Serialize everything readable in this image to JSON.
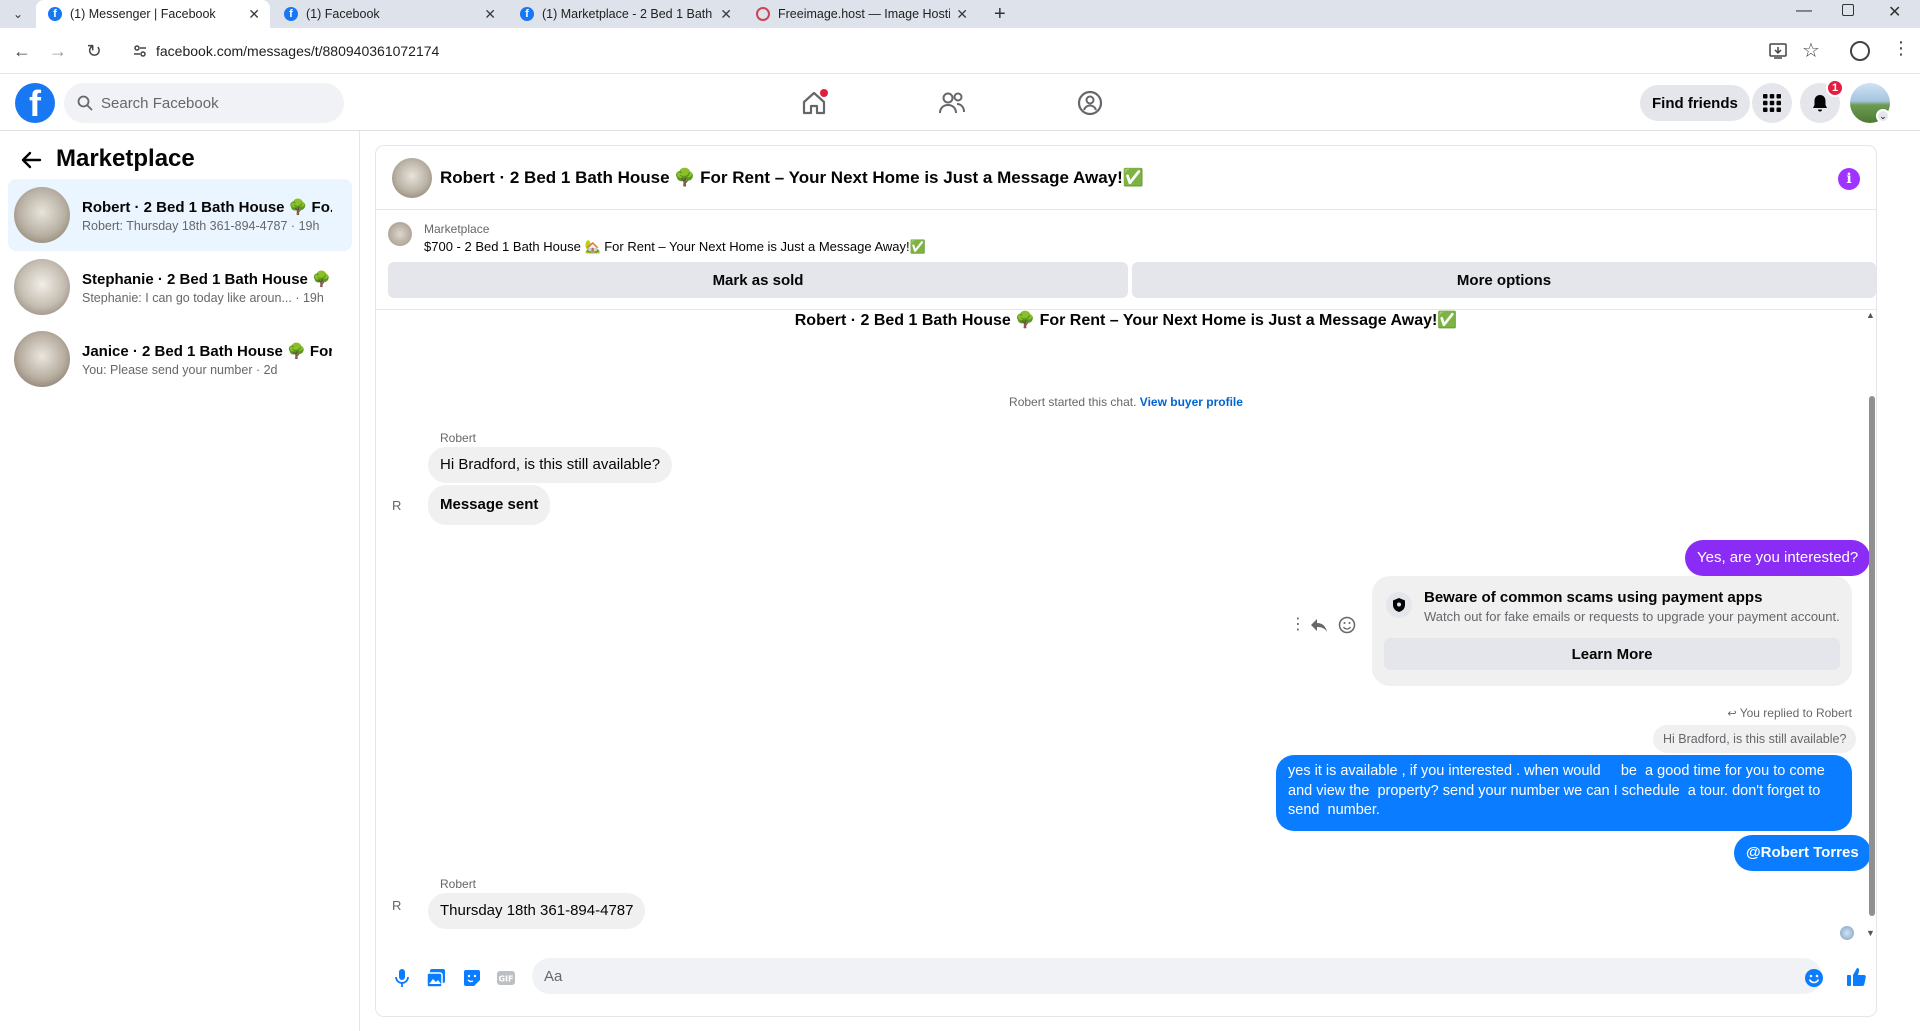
{
  "browser": {
    "tabs": [
      {
        "title": "(1) Messenger | Facebook",
        "active": true
      },
      {
        "title": "(1) Facebook",
        "active": false
      },
      {
        "title": "(1) Marketplace - 2 Bed 1 Bath H",
        "active": false
      },
      {
        "title": "Freeimage.host — Image Hostin",
        "active": false
      }
    ],
    "url": "facebook.com/messages/t/880940361072174"
  },
  "header": {
    "logo": "f",
    "search_placeholder": "Search Facebook",
    "find_friends": "Find friends",
    "notification_count": "1"
  },
  "sidebar": {
    "title": "Marketplace",
    "conversations": [
      {
        "name": "Robert · 2 Bed 1 Bath House 🌳 Fo...",
        "preview": "Robert: Thursday 18th 361-894-4787 · 19h",
        "selected": true
      },
      {
        "name": "Stephanie · 2 Bed 1 Bath House 🌳 ...",
        "preview": "Stephanie: I can go today like aroun... · 19h",
        "selected": false
      },
      {
        "name": "Janice · 2 Bed 1 Bath House 🌳 For...",
        "preview": "You: Please send your number · 2d",
        "selected": false
      }
    ]
  },
  "chat": {
    "title": "Robert · 2 Bed 1 Bath House 🌳 For Rent – Your Next Home is Just a Message Away!✅",
    "listing": {
      "source": "Marketplace",
      "title": "$700 - 2 Bed 1 Bath House 🏡 For Rent – Your Next Home is Just a Message Away!✅",
      "mark_sold": "Mark as sold",
      "more_options": "More options"
    },
    "thread_title": "Robert · 2 Bed 1 Bath House 🌳 For Rent – Your Next Home is Just a Message Away!✅",
    "started_text": "Robert started this chat.",
    "view_profile": "View buyer profile",
    "sender_name": "Robert",
    "msg1": "Hi Bradford, is this still available?",
    "msg2": "Message sent",
    "msg3": "Yes, are you interested?",
    "scam_title": "Beware of common scams using payment apps",
    "scam_body": "Watch out for fake emails or requests to upgrade your payment account.",
    "learn_more": "Learn More",
    "replied_to": "You replied to Robert",
    "reply_quote": "Hi Bradford, is this still available?",
    "msg4_lines": [
      "yes it is available , if you interested . when would     be  a good time for you to come",
      "and view the  property? send your number we can I schedule  a tour. don't forget to",
      "send  number."
    ],
    "mention": "@Robert Torres",
    "sender_name2": "Robert",
    "msg5": "Thursday 18th 361-894-4787",
    "broken_img_alt": "R",
    "composer_placeholder": "Aa"
  },
  "colors": {
    "brand_blue": "#1877f2",
    "outgoing_bubble": "#0a7cff",
    "purple_bubble": "#8a2cf6",
    "incoming_bubble": "#f0f0f0"
  }
}
